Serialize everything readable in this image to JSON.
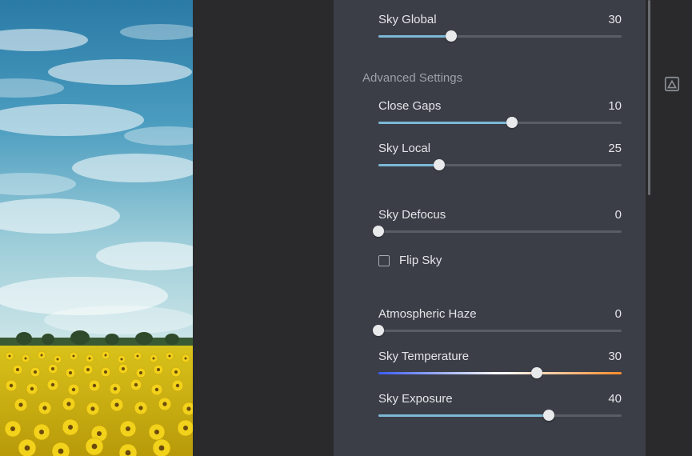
{
  "panel": {
    "advanced_header": "Advanced Settings",
    "sliders": {
      "sky_global": {
        "label": "Sky Global",
        "value": 30,
        "min": 0,
        "max": 100
      },
      "close_gaps": {
        "label": "Close Gaps",
        "value": 10,
        "min": -100,
        "max": 100
      },
      "sky_local": {
        "label": "Sky Local",
        "value": 25,
        "min": 0,
        "max": 100
      },
      "sky_defocus": {
        "label": "Sky Defocus",
        "value": 0,
        "min": 0,
        "max": 100
      },
      "atm_haze": {
        "label": "Atmospheric Haze",
        "value": 0,
        "min": 0,
        "max": 100
      },
      "sky_temp": {
        "label": "Sky Temperature",
        "value": 30,
        "min": -100,
        "max": 100
      },
      "sky_exposure": {
        "label": "Sky Exposure",
        "value": 40,
        "min": -100,
        "max": 100
      }
    },
    "flip_sky": {
      "label": "Flip Sky",
      "checked": false
    }
  },
  "colors": {
    "accent": "#7cb8d6",
    "panel_bg": "#3b3e47",
    "app_bg": "#2a2a2d",
    "temp_gradient": [
      "#3a5cff",
      "#ffffff",
      "#ff8a2a"
    ]
  }
}
